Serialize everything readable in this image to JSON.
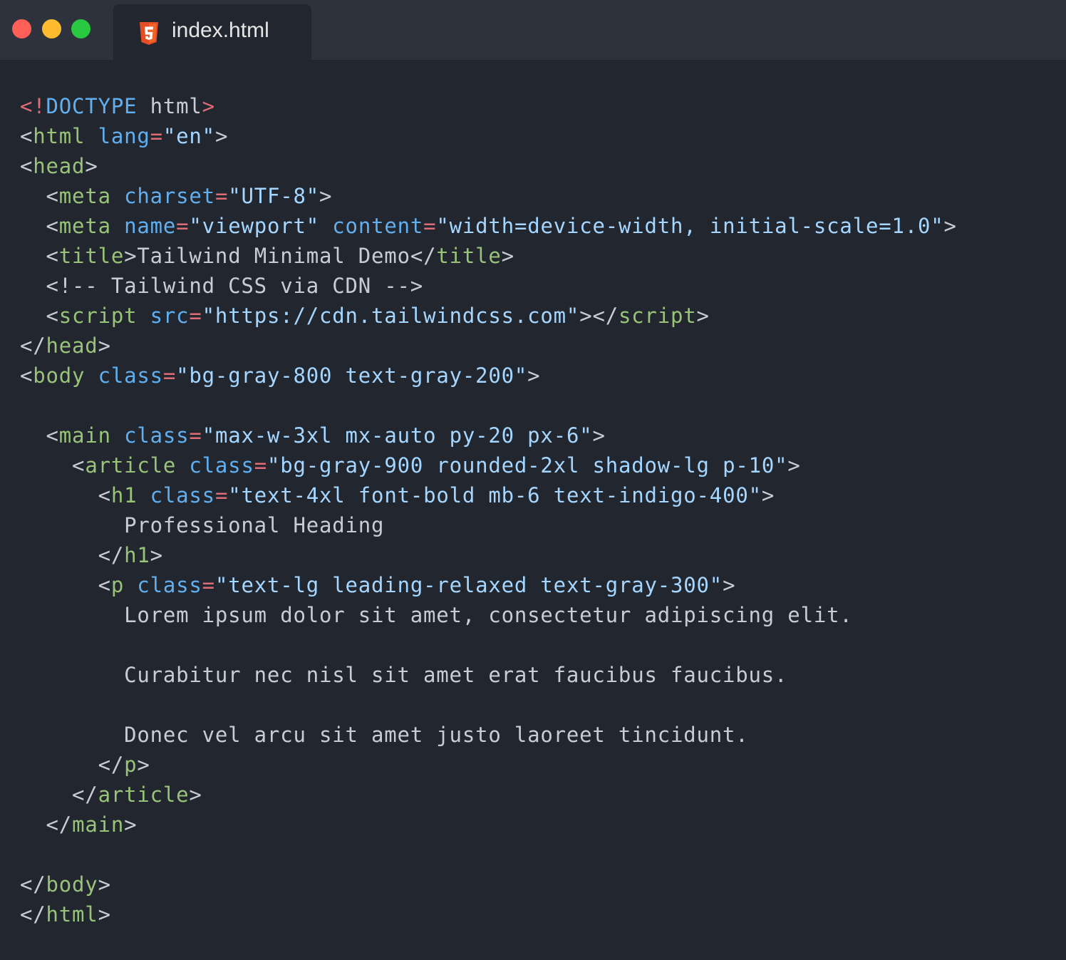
{
  "window": {
    "controls": [
      "close",
      "minimize",
      "maximize"
    ],
    "tab": {
      "label": "index.html",
      "icon": "html5-icon"
    }
  },
  "colors": {
    "background": "#22262f",
    "titlebar": "#2e323c",
    "tag": "#98c379",
    "attribute": "#61afef",
    "string": "#a5d6ff",
    "doctype_bracket": "#e06c75",
    "text": "#c8ccd4"
  },
  "code": {
    "lines": [
      [
        {
          "t": "decl",
          "v": "<!"
        },
        {
          "t": "doctype",
          "v": "DOCTYPE"
        },
        {
          "t": "text",
          "v": " html"
        },
        {
          "t": "decl",
          "v": ">"
        }
      ],
      [
        {
          "t": "punct",
          "v": "<"
        },
        {
          "t": "tag",
          "v": "html"
        },
        {
          "t": "text",
          "v": " "
        },
        {
          "t": "attr",
          "v": "lang"
        },
        {
          "t": "eq",
          "v": "="
        },
        {
          "t": "str",
          "v": "\"en\""
        },
        {
          "t": "punct",
          "v": ">"
        }
      ],
      [
        {
          "t": "punct",
          "v": "<"
        },
        {
          "t": "tag",
          "v": "head"
        },
        {
          "t": "punct",
          "v": ">"
        }
      ],
      [
        {
          "t": "text",
          "v": "  "
        },
        {
          "t": "punct",
          "v": "<"
        },
        {
          "t": "tag",
          "v": "meta"
        },
        {
          "t": "text",
          "v": " "
        },
        {
          "t": "attr",
          "v": "charset"
        },
        {
          "t": "eq",
          "v": "="
        },
        {
          "t": "str",
          "v": "\"UTF-8\""
        },
        {
          "t": "punct",
          "v": ">"
        }
      ],
      [
        {
          "t": "text",
          "v": "  "
        },
        {
          "t": "punct",
          "v": "<"
        },
        {
          "t": "tag",
          "v": "meta"
        },
        {
          "t": "text",
          "v": " "
        },
        {
          "t": "attr",
          "v": "name"
        },
        {
          "t": "eq",
          "v": "="
        },
        {
          "t": "str",
          "v": "\"viewport\""
        },
        {
          "t": "text",
          "v": " "
        },
        {
          "t": "attr",
          "v": "content"
        },
        {
          "t": "eq",
          "v": "="
        },
        {
          "t": "str",
          "v": "\"width=device-width, initial-scale=1.0\""
        },
        {
          "t": "punct",
          "v": ">"
        }
      ],
      [
        {
          "t": "text",
          "v": "  "
        },
        {
          "t": "punct",
          "v": "<"
        },
        {
          "t": "tag",
          "v": "title"
        },
        {
          "t": "punct",
          "v": ">"
        },
        {
          "t": "text",
          "v": "Tailwind Minimal Demo"
        },
        {
          "t": "punct",
          "v": "</"
        },
        {
          "t": "tag",
          "v": "title"
        },
        {
          "t": "punct",
          "v": ">"
        }
      ],
      [
        {
          "t": "text",
          "v": "  "
        },
        {
          "t": "comment",
          "v": "<!-- Tailwind CSS via CDN -->"
        }
      ],
      [
        {
          "t": "text",
          "v": "  "
        },
        {
          "t": "punct",
          "v": "<"
        },
        {
          "t": "tag",
          "v": "script"
        },
        {
          "t": "text",
          "v": " "
        },
        {
          "t": "attr",
          "v": "src"
        },
        {
          "t": "eq",
          "v": "="
        },
        {
          "t": "str",
          "v": "\"https://cdn.tailwindcss.com\""
        },
        {
          "t": "punct",
          "v": "></"
        },
        {
          "t": "tag",
          "v": "script"
        },
        {
          "t": "punct",
          "v": ">"
        }
      ],
      [
        {
          "t": "punct",
          "v": "</"
        },
        {
          "t": "tag",
          "v": "head"
        },
        {
          "t": "punct",
          "v": ">"
        }
      ],
      [
        {
          "t": "punct",
          "v": "<"
        },
        {
          "t": "tag",
          "v": "body"
        },
        {
          "t": "text",
          "v": " "
        },
        {
          "t": "attr",
          "v": "class"
        },
        {
          "t": "eq",
          "v": "="
        },
        {
          "t": "str",
          "v": "\"bg-gray-800 text-gray-200\""
        },
        {
          "t": "punct",
          "v": ">"
        }
      ],
      [],
      [
        {
          "t": "text",
          "v": "  "
        },
        {
          "t": "punct",
          "v": "<"
        },
        {
          "t": "tag",
          "v": "main"
        },
        {
          "t": "text",
          "v": " "
        },
        {
          "t": "attr",
          "v": "class"
        },
        {
          "t": "eq",
          "v": "="
        },
        {
          "t": "str",
          "v": "\"max-w-3xl mx-auto py-20 px-6\""
        },
        {
          "t": "punct",
          "v": ">"
        }
      ],
      [
        {
          "t": "text",
          "v": "    "
        },
        {
          "t": "punct",
          "v": "<"
        },
        {
          "t": "tag",
          "v": "article"
        },
        {
          "t": "text",
          "v": " "
        },
        {
          "t": "attr",
          "v": "class"
        },
        {
          "t": "eq",
          "v": "="
        },
        {
          "t": "str",
          "v": "\"bg-gray-900 rounded-2xl shadow-lg p-10\""
        },
        {
          "t": "punct",
          "v": ">"
        }
      ],
      [
        {
          "t": "text",
          "v": "      "
        },
        {
          "t": "punct",
          "v": "<"
        },
        {
          "t": "tag",
          "v": "h1"
        },
        {
          "t": "text",
          "v": " "
        },
        {
          "t": "attr",
          "v": "class"
        },
        {
          "t": "eq",
          "v": "="
        },
        {
          "t": "str",
          "v": "\"text-4xl font-bold mb-6 text-indigo-400\""
        },
        {
          "t": "punct",
          "v": ">"
        }
      ],
      [
        {
          "t": "text",
          "v": "        Professional Heading"
        }
      ],
      [
        {
          "t": "text",
          "v": "      "
        },
        {
          "t": "punct",
          "v": "</"
        },
        {
          "t": "tag",
          "v": "h1"
        },
        {
          "t": "punct",
          "v": ">"
        }
      ],
      [
        {
          "t": "text",
          "v": "      "
        },
        {
          "t": "punct",
          "v": "<"
        },
        {
          "t": "tag",
          "v": "p"
        },
        {
          "t": "text",
          "v": " "
        },
        {
          "t": "attr",
          "v": "class"
        },
        {
          "t": "eq",
          "v": "="
        },
        {
          "t": "str",
          "v": "\"text-lg leading-relaxed text-gray-300\""
        },
        {
          "t": "punct",
          "v": ">"
        }
      ],
      [
        {
          "t": "text",
          "v": "        Lorem ipsum dolor sit amet, consectetur adipiscing elit."
        }
      ],
      [],
      [
        {
          "t": "text",
          "v": "        Curabitur nec nisl sit amet erat faucibus faucibus."
        }
      ],
      [],
      [
        {
          "t": "text",
          "v": "        Donec vel arcu sit amet justo laoreet tincidunt."
        }
      ],
      [
        {
          "t": "text",
          "v": "      "
        },
        {
          "t": "punct",
          "v": "</"
        },
        {
          "t": "tag",
          "v": "p"
        },
        {
          "t": "punct",
          "v": ">"
        }
      ],
      [
        {
          "t": "text",
          "v": "    "
        },
        {
          "t": "punct",
          "v": "</"
        },
        {
          "t": "tag",
          "v": "article"
        },
        {
          "t": "punct",
          "v": ">"
        }
      ],
      [
        {
          "t": "text",
          "v": "  "
        },
        {
          "t": "punct",
          "v": "</"
        },
        {
          "t": "tag",
          "v": "main"
        },
        {
          "t": "punct",
          "v": ">"
        }
      ],
      [],
      [
        {
          "t": "punct",
          "v": "</"
        },
        {
          "t": "tag",
          "v": "body"
        },
        {
          "t": "punct",
          "v": ">"
        }
      ],
      [
        {
          "t": "punct",
          "v": "</"
        },
        {
          "t": "tag",
          "v": "html"
        },
        {
          "t": "punct",
          "v": ">"
        }
      ]
    ]
  }
}
